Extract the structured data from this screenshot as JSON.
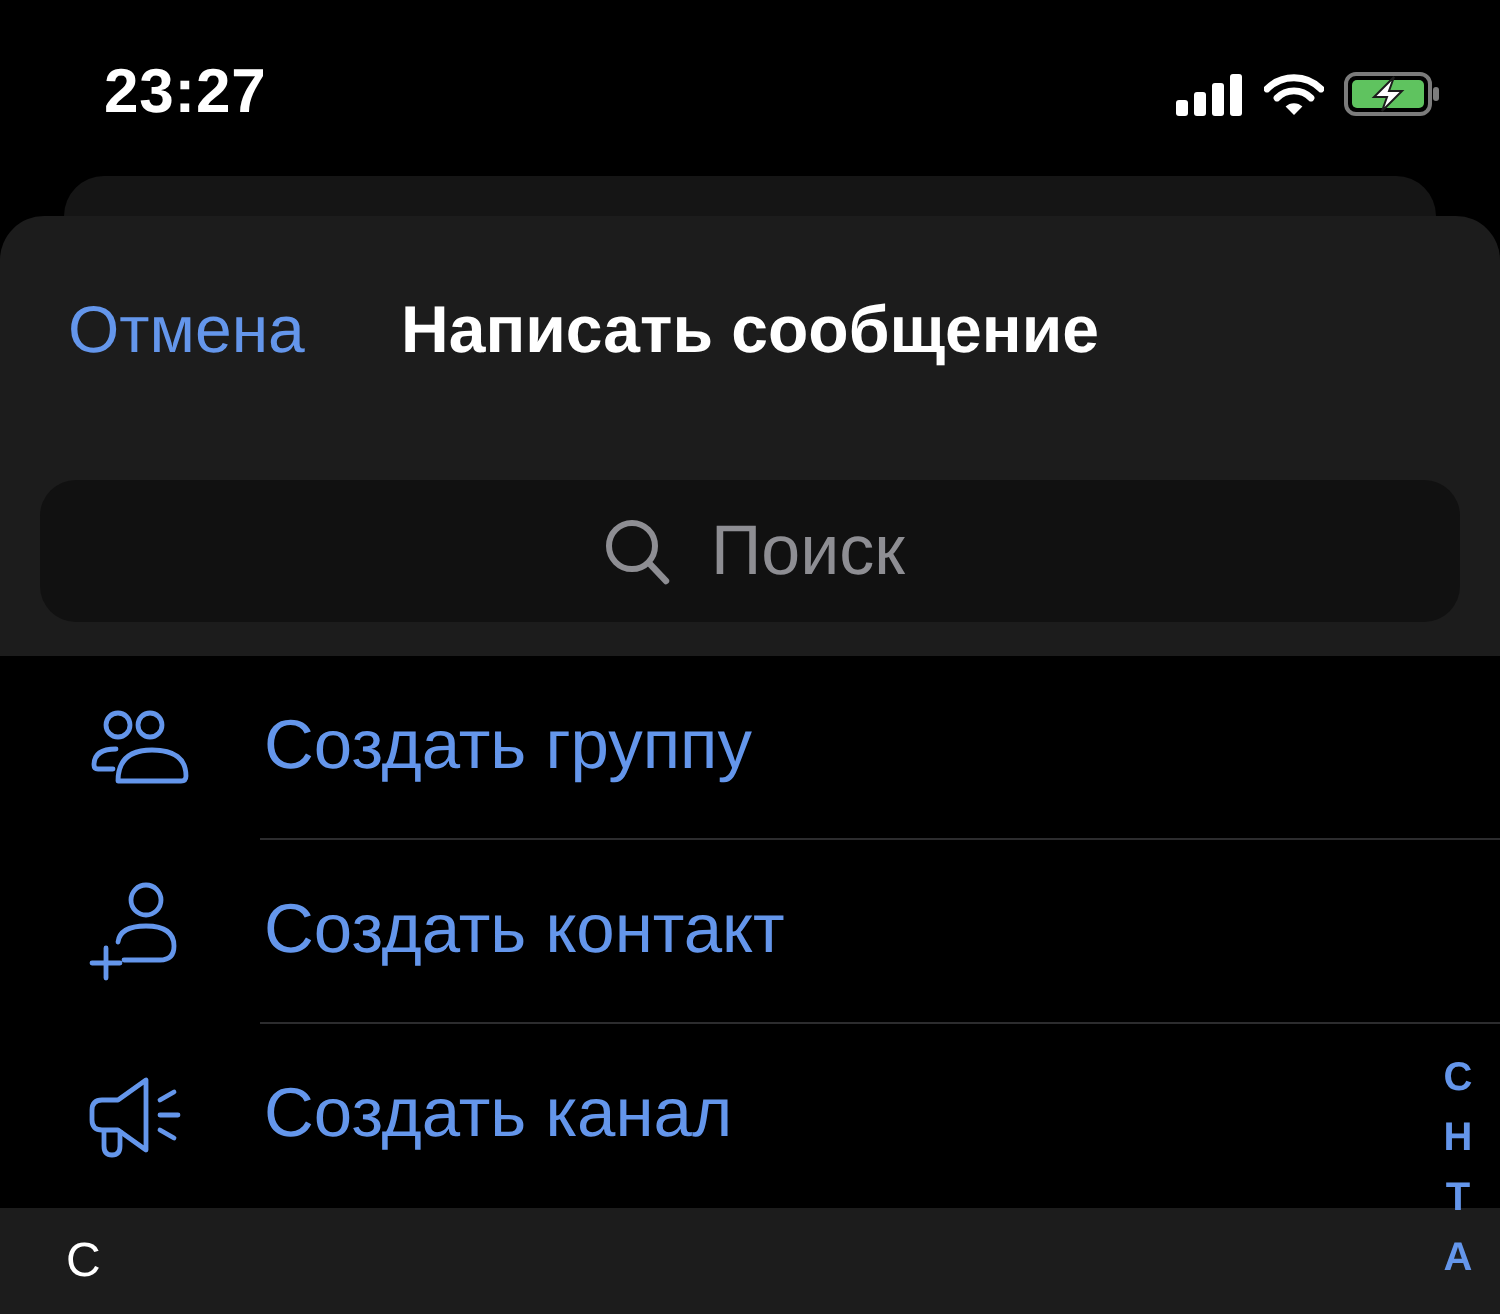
{
  "status_bar": {
    "time": "23:27"
  },
  "header": {
    "cancel": "Отмена",
    "title": "Написать сообщение"
  },
  "search": {
    "placeholder": "Поиск"
  },
  "actions": [
    {
      "kind": "group",
      "label": "Создать группу"
    },
    {
      "kind": "contact",
      "label": "Создать контакт"
    },
    {
      "kind": "channel",
      "label": "Создать канал"
    }
  ],
  "section_header": "С",
  "index_letters": [
    "С",
    "Н",
    "Т",
    "А"
  ]
}
